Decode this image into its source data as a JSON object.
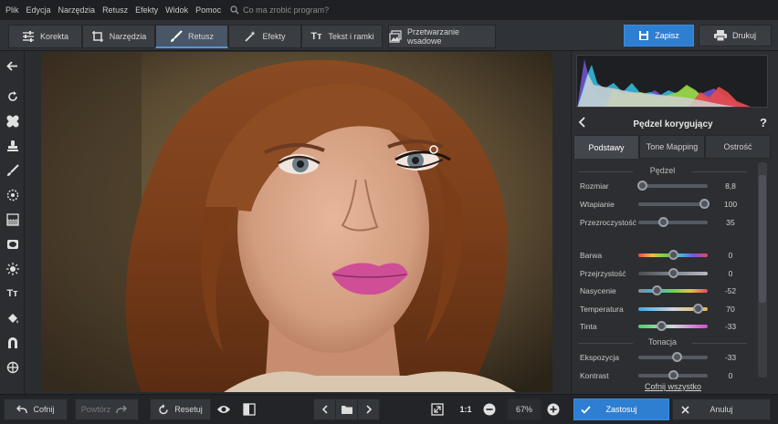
{
  "menu": {
    "items": [
      "Plik",
      "Edycja",
      "Narzędzia",
      "Retusz",
      "Efekty",
      "Widok",
      "Pomoc"
    ],
    "search_placeholder": "Co ma zrobić program?"
  },
  "tabs": [
    {
      "label": "Korekta",
      "icon": "sliders-icon"
    },
    {
      "label": "Narzędzia",
      "icon": "crop-icon"
    },
    {
      "label": "Retusz",
      "icon": "brush-icon"
    },
    {
      "label": "Efekty",
      "icon": "magic-wand-icon"
    },
    {
      "label": "Tekst i ramki",
      "icon": "text-icon"
    },
    {
      "label": "Przetwarzanie wsadowe",
      "icon": "batch-icon"
    }
  ],
  "active_tab": "Retusz",
  "header_buttons": {
    "save": "Zapisz",
    "print": "Drukuj"
  },
  "panel": {
    "title": "Pędzel korygujący",
    "help": "?",
    "subtabs": [
      "Podstawy",
      "Tone Mapping",
      "Ostrość"
    ],
    "active_subtab": "Podstawy",
    "section_brush": "Pędzel",
    "brush_rows": [
      {
        "label": "Rozmiar",
        "value": "8,8",
        "position": 0.05
      },
      {
        "label": "Wtapianie",
        "value": "100",
        "position": 0.95
      },
      {
        "label": "Przezroczystość",
        "value": "35",
        "position": 0.35
      }
    ],
    "color_rows": [
      {
        "label": "Barwa",
        "value": "0",
        "position": 0.5
      },
      {
        "label": "Przejrzystość",
        "value": "0",
        "position": 0.5
      },
      {
        "label": "Nasycenie",
        "value": "-52",
        "position": 0.26
      },
      {
        "label": "Temperatura",
        "value": "70",
        "position": 0.85
      },
      {
        "label": "Tinta",
        "value": "-33",
        "position": 0.33
      }
    ],
    "section_tone": "Tonacja",
    "tone_rows": [
      {
        "label": "Ekspozycja",
        "value": "-33",
        "position": 0.55
      },
      {
        "label": "Kontrast",
        "value": "0",
        "position": 0.5
      }
    ],
    "reset_all": "Cofnij wszystko"
  },
  "bottom": {
    "undo": "Cofnij",
    "redo": "Powtórz",
    "reset": "Resetuj",
    "zoom_1to1": "1:1",
    "zoom_value": "67%",
    "apply": "Zastosuj",
    "cancel": "Anuluj"
  },
  "colors": {
    "accent": "#2e7fd2",
    "active_tab": "#4a5566"
  }
}
